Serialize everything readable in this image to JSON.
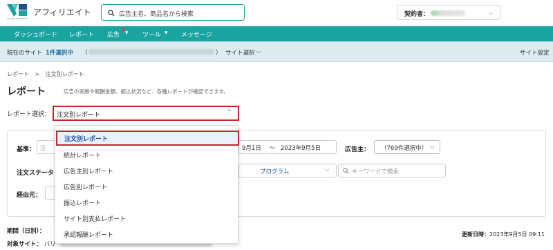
{
  "header": {
    "brand_sub": "VALUECOMMERCE",
    "app_title": "アフィリエイト",
    "search_placeholder": "広告主名、商品名から検索",
    "contract_label": "契約者：",
    "colors": {
      "brand": "#1aa4a0",
      "highlight": "#c1272d"
    }
  },
  "nav": {
    "items": [
      {
        "label": "ダッシュボード"
      },
      {
        "label": "レポート"
      },
      {
        "label": "広告"
      },
      {
        "label": "ツール"
      },
      {
        "label": "メッセージ"
      }
    ]
  },
  "sitebar": {
    "current_label": "現在のサイト",
    "count": "1件選択中",
    "site_select": "サイト選択",
    "settings": "サイト設定"
  },
  "breadcrumb": {
    "parent": "レポート",
    "separator": ">",
    "current": "注文別レポート"
  },
  "page": {
    "title": "レポート",
    "description": "広告の実績や報酬金額、振込状況など、各種レポートが確認できます。",
    "select_label": "レポート選択：",
    "selected_report": "注文別レポート"
  },
  "filters": {
    "basis_label": "基準：",
    "basis_value": "注",
    "date_from": "9月1日",
    "date_sep": "～",
    "date_to": "2023年9月5日",
    "advertiser_label": "広告主：",
    "advertiser_value": "（769件選択中）",
    "status_label": "注文ステータ",
    "program_value": "プログラム",
    "keyword_placeholder": "キーワードで検索",
    "route_label": "経由元："
  },
  "bottom": {
    "period_label": "期間（日別）：",
    "target_label": "対象サイト：",
    "target_value": "バリ",
    "updated_label": "更新日時：",
    "updated_value": "2023年9月5日 09:11"
  },
  "menu": {
    "items": [
      {
        "label": "注文別レポート"
      },
      {
        "label": "統計レポート"
      },
      {
        "label": "広告主別レポート"
      },
      {
        "label": "広告別レポート"
      },
      {
        "label": "振込レポート"
      },
      {
        "label": "サイト別支払レポート"
      },
      {
        "label": "承認報酬レポート"
      }
    ]
  }
}
